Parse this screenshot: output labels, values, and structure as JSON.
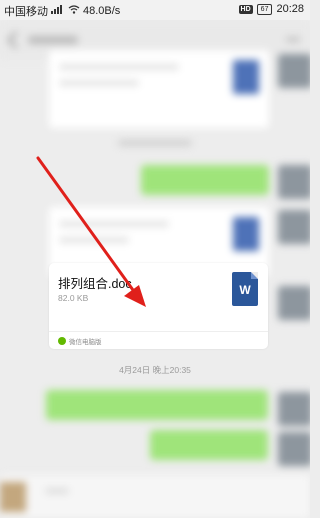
{
  "status_bar": {
    "carrier": "中国移动",
    "network_speed": "48.0B/s",
    "hd_badge": "HD",
    "battery": "67",
    "time": "20:28"
  },
  "file_message": {
    "file_name": "排列组合.doc",
    "file_size": "82.0 KB",
    "file_type_letter": "W",
    "source_label": "微信电脑版"
  },
  "timestamp": "4月24日 晚上20:35",
  "icons": {
    "signal": "signal-icon",
    "wifi": "wifi-icon",
    "word_doc": "word-document-icon",
    "source": "wechat-pc-icon",
    "annotation": "red-arrow-icon"
  },
  "colors": {
    "bubble_green": "#9fe47a",
    "word_blue": "#2b579a",
    "arrow_red": "#e0201b"
  }
}
